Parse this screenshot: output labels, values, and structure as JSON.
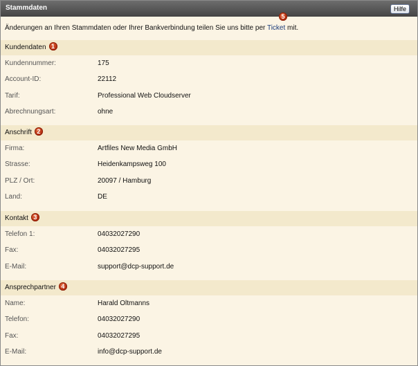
{
  "header": {
    "title": "Stammdaten",
    "help_label": "Hilfe",
    "badge": "5"
  },
  "intro": {
    "before_link": "Änderungen an Ihren Stammdaten oder Ihrer Bankverbindung teilen Sie uns bitte per ",
    "link": "Ticket",
    "after_link": " mit."
  },
  "sections": [
    {
      "title": "Kundendaten",
      "badge": "1",
      "rows": [
        {
          "label": "Kundennummer:",
          "value": "175"
        },
        {
          "label": "Account-ID:",
          "value": "22112"
        },
        {
          "label": "Tarif:",
          "value": "Professional Web Cloudserver"
        },
        {
          "label": "Abrechnungsart:",
          "value": "ohne"
        }
      ]
    },
    {
      "title": "Anschrift",
      "badge": "2",
      "rows": [
        {
          "label": "Firma:",
          "value": "Artfiles New Media GmbH"
        },
        {
          "label": "Strasse:",
          "value": "Heidenkampsweg 100"
        },
        {
          "label": "PLZ / Ort:",
          "value": "20097 / Hamburg"
        },
        {
          "label": "Land:",
          "value": "DE"
        }
      ]
    },
    {
      "title": "Kontakt",
      "badge": "3",
      "rows": [
        {
          "label": "Telefon 1:",
          "value": "04032027290"
        },
        {
          "label": "Fax:",
          "value": "04032027295"
        },
        {
          "label": "E-Mail:",
          "value": "support@dcp-support.de"
        }
      ]
    },
    {
      "title": "Ansprechpartner",
      "badge": "4",
      "rows": [
        {
          "label": "Name:",
          "value": "Harald Oltmanns"
        },
        {
          "label": "Telefon:",
          "value": "04032027290"
        },
        {
          "label": "Fax:",
          "value": "04032027295"
        },
        {
          "label": "E-Mail:",
          "value": "info@dcp-support.de"
        }
      ]
    }
  ]
}
